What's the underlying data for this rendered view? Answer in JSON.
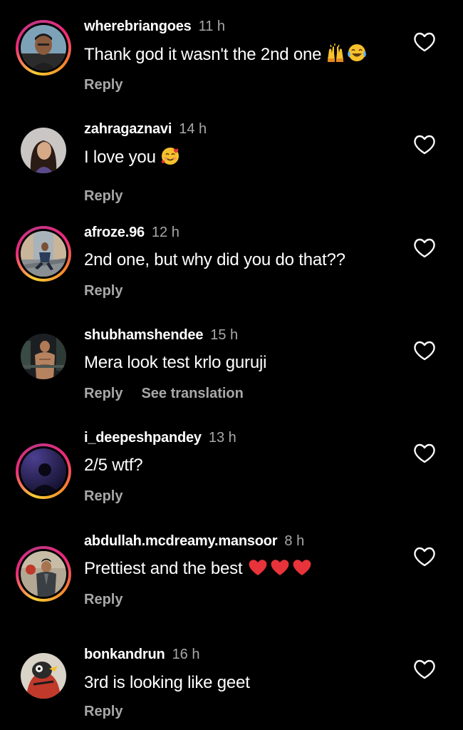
{
  "comments": [
    {
      "username": "wherebriangoes",
      "time": "11 h",
      "text": "Thank god it wasn't the 2nd one",
      "emoji": [
        "raising-hands",
        "tears-of-joy"
      ],
      "reply_label": "Reply",
      "avatar_ring": "story"
    },
    {
      "username": "zahragaznavi",
      "time": "14 h",
      "text": "I love you",
      "emoji": [
        "smiling-face-with-hearts"
      ],
      "reply_label": "Reply",
      "avatar_ring": "none"
    },
    {
      "username": "afroze.96",
      "time": "12 h",
      "text": "2nd one, but why did you do that??",
      "emoji": [],
      "reply_label": "Reply",
      "avatar_ring": "story"
    },
    {
      "username": "shubhamshendee",
      "time": "15 h",
      "text": "Mera look test krlo guruji",
      "emoji": [],
      "reply_label": "Reply",
      "see_translation_label": "See translation",
      "avatar_ring": "none"
    },
    {
      "username": "i_deepeshpandey",
      "time": "13 h",
      "text": "2/5 wtf?",
      "emoji": [],
      "reply_label": "Reply",
      "avatar_ring": "story"
    },
    {
      "username": "abdullah.mcdreamy.mansoor",
      "time": "8 h",
      "text": "Prettiest and the best",
      "emoji": [
        "red-heart",
        "red-heart",
        "red-heart"
      ],
      "reply_label": "Reply",
      "avatar_ring": "story"
    },
    {
      "username": "bonkandrun",
      "time": "16 h",
      "text": "3rd is looking like geet",
      "emoji": [],
      "reply_label": "Reply",
      "avatar_ring": "none"
    }
  ],
  "icons": {
    "like": "heart-outline-icon"
  },
  "colors": {
    "background": "#000000",
    "primary_text": "#ffffff",
    "secondary_text": "#a8a8a8",
    "heart_emoji": "#e8333a"
  }
}
